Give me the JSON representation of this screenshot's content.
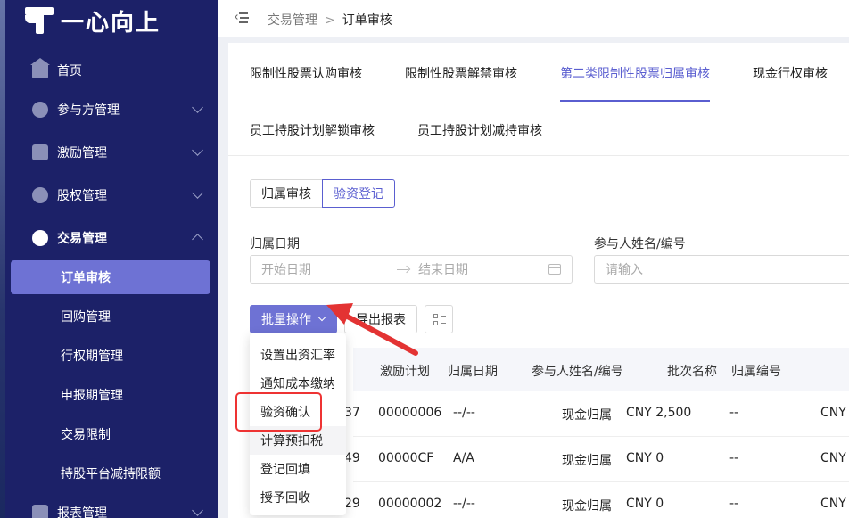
{
  "app": {
    "logo_text": "一心向上"
  },
  "sidebar": {
    "items": [
      {
        "label": "首页"
      },
      {
        "label": "参与方管理"
      },
      {
        "label": "激励管理"
      },
      {
        "label": "股权管理"
      },
      {
        "label": "交易管理"
      }
    ],
    "sub_items": [
      {
        "label": "订单审核"
      },
      {
        "label": "回购管理"
      },
      {
        "label": "行权期管理"
      },
      {
        "label": "申报期管理"
      },
      {
        "label": "交易限制"
      },
      {
        "label": "持股平台减持限额"
      }
    ],
    "bottom_item": {
      "label": "报表管理"
    }
  },
  "breadcrumb": {
    "parent": "交易管理",
    "separator": ">",
    "current": "订单审核"
  },
  "tabs": [
    {
      "label": "限制性股票认购审核"
    },
    {
      "label": "限制性股票解禁审核"
    },
    {
      "label": "第二类限制性股票归属审核"
    },
    {
      "label": "现金行权审核"
    },
    {
      "label": "员工持股计划解锁审核"
    },
    {
      "label": "员工持股计划减持审核"
    }
  ],
  "segmented": {
    "left": "归属审核",
    "right": "验资登记"
  },
  "filters": {
    "date_label": "归属日期",
    "start_placeholder": "开始日期",
    "end_placeholder": "结束日期",
    "participant_label": "参与人姓名/编号",
    "participant_placeholder": "请输入"
  },
  "toolbar": {
    "batch_label": "批量操作",
    "export_label": "导出报表"
  },
  "dropdown": {
    "items": [
      {
        "label": "设置出资汇率"
      },
      {
        "label": "通知成本缴纳"
      },
      {
        "label": "验资确认"
      },
      {
        "label": "计算预扣税"
      },
      {
        "label": "登记回填"
      },
      {
        "label": "授予回收"
      }
    ]
  },
  "table": {
    "columns": [
      "激励计划",
      "归属日期",
      "参与人姓名/编号",
      "批次名称",
      "归属编号"
    ],
    "rows": [
      {
        "c0": "37",
        "c1": "00000006",
        "c2": "--/--",
        "c3": "现金归属",
        "c4": "CNY 2,500",
        "c5": "--",
        "c6": "CNY"
      },
      {
        "c0": "49",
        "c1": "00000CF",
        "c2": "A/A",
        "c3": "现金归属",
        "c4": "CNY 0",
        "c5": "--",
        "c6": "CNY"
      },
      {
        "c0": "29",
        "c1": "00000002",
        "c2": "--/--",
        "c3": "现金归属",
        "c4": "CNY 0",
        "c5": "--",
        "c6": "CNY"
      }
    ]
  },
  "colors": {
    "sidebar_bg": "#1c2168",
    "accent": "#6e72d4",
    "annotation": "#e33333"
  }
}
